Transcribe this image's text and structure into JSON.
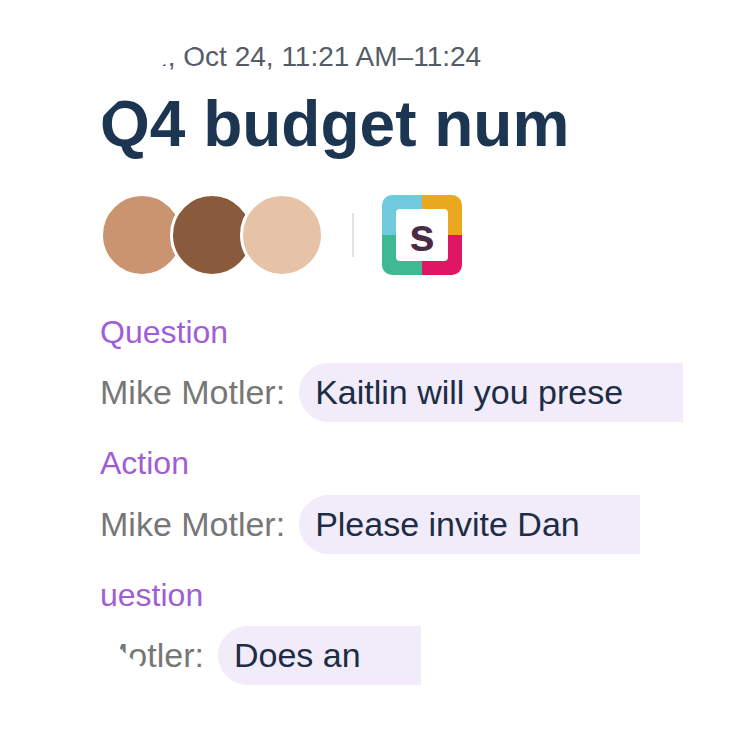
{
  "header": {
    "time": "., Oct 24, 11:21 AM–11:24",
    "title": "Q4 budget num"
  },
  "participants": [
    {
      "color": "#c9946f"
    },
    {
      "color": "#8a5a3c"
    },
    {
      "color": "#e6c3a6"
    }
  ],
  "app": {
    "logo_letter": "s"
  },
  "items": [
    {
      "kind": "question",
      "label": "Question",
      "speaker": "Mike Motler:",
      "text": "Kaitlin will you prese"
    },
    {
      "kind": "action",
      "label": "Action",
      "speaker": "Mike Motler:",
      "text": "Please invite Dan"
    },
    {
      "kind": "question",
      "label": "uestion",
      "speaker": "Motler:",
      "text": "Does an"
    }
  ]
}
